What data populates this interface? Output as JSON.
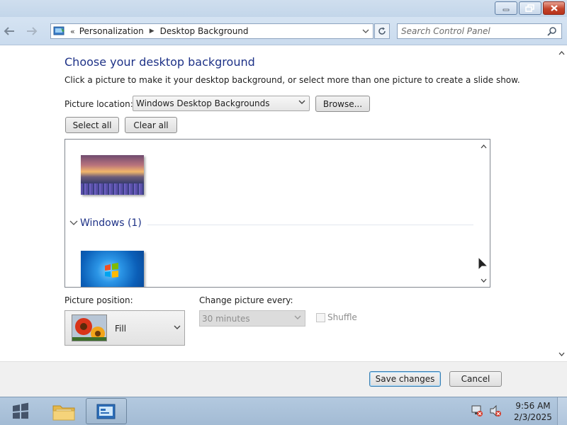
{
  "window": {
    "controls": {
      "minimize": "minimize",
      "maximize": "restore",
      "close": "close"
    }
  },
  "address_bar": {
    "overflow": "«",
    "breadcrumbs": [
      "Personalization",
      "Desktop Background"
    ],
    "search_placeholder": "Search Control Panel"
  },
  "page": {
    "heading": "Choose your desktop background",
    "description": "Click a picture to make it your desktop background, or select more than one picture to create a slide show.",
    "picture_location_label": "Picture location:",
    "picture_location_value": "Windows Desktop Backgrounds",
    "browse_label": "Browse...",
    "select_all_label": "Select all",
    "clear_all_label": "Clear all",
    "groups": [
      {
        "name": "Windows (1)"
      }
    ],
    "picture_position_label": "Picture position:",
    "picture_position_value": "Fill",
    "change_every_label": "Change picture every:",
    "change_every_value": "30 minutes",
    "shuffle_label": "Shuffle",
    "shuffle_checked": false
  },
  "footer": {
    "save_label": "Save changes",
    "cancel_label": "Cancel"
  },
  "taskbar": {
    "items": [
      "start-button",
      "windows-explorer",
      "control-panel"
    ],
    "time": "9:56 AM",
    "date": "2/3/2025"
  },
  "colors": {
    "heading": "#1e3287",
    "taskbar": "#a3bbd4",
    "titlebar": "#c3d6ea"
  }
}
